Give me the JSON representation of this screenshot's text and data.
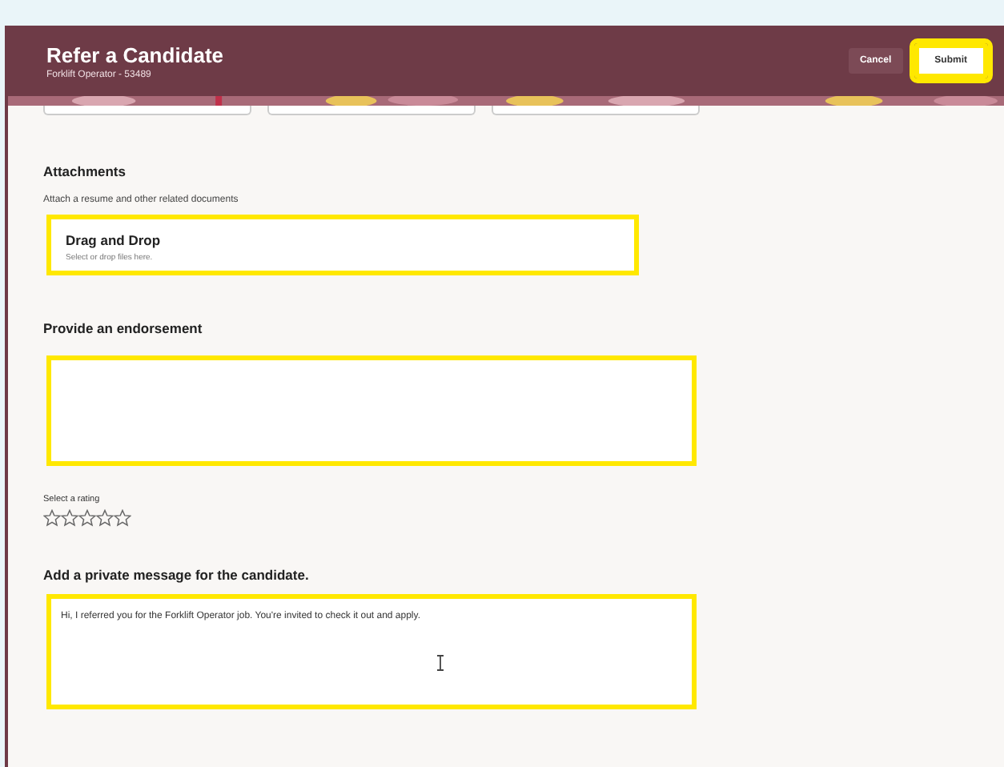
{
  "header": {
    "title": "Refer a Candidate",
    "subtitle": "Forklift Operator - 53489",
    "buttons": [
      {
        "kind": "secondary",
        "label": "Cancel",
        "highlighted": false
      },
      {
        "kind": "primary",
        "label": "Submit",
        "highlighted": true
      }
    ]
  },
  "attachments": {
    "heading": "Attachments",
    "description": "Attach a resume and other related documents",
    "dropzone": {
      "title": "Drag and Drop",
      "hint": "Select or drop files here.",
      "highlighted": true
    }
  },
  "endorsement": {
    "heading": "Provide an endorsement",
    "highlighted": true
  },
  "rating": {
    "label": "Select a rating",
    "stars": 0
  },
  "message": {
    "heading": "Add a private message for the candidate.",
    "value": "Hi, I referred you for the Forklift Operator job. You're invited to check it out and apply.",
    "highlighted": true
  }
}
